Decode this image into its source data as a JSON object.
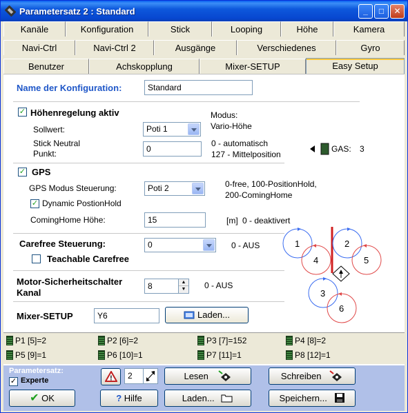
{
  "window": {
    "title": "Parametersatz 2 : Standard",
    "min": "_",
    "max": "□",
    "close": "✕"
  },
  "tabs": {
    "row1": [
      "Kanäle",
      "Konfiguration",
      "Stick",
      "Looping",
      "Höhe",
      "Kamera"
    ],
    "row2": [
      "Navi-Ctrl",
      "Navi-Ctrl 2",
      "Ausgänge",
      "Verschiedenes",
      "Gyro"
    ],
    "row3": [
      "Benutzer",
      "Achskopplung",
      "Mixer-SETUP",
      "Easy Setup"
    ]
  },
  "config": {
    "name_label": "Name der Konfiguration:",
    "name_value": "Standard"
  },
  "hoehe": {
    "checkbox_label": "Höhenregelung aktiv",
    "sollwert_label": "Sollwert:",
    "sollwert_value": "Poti 1",
    "modus_label": "Modus:",
    "modus_value": "Vario-Höhe",
    "stick_neutral_label_1": "Stick Neutral",
    "stick_neutral_label_2": "Punkt:",
    "stick_neutral_value": "0",
    "hint_1": "0 - automatisch",
    "hint_2": "127 - Mittelposition",
    "gas_label": "GAS:",
    "gas_value": "3"
  },
  "gps": {
    "checkbox_label": "GPS",
    "modus_label": "GPS Modus Steuerung:",
    "modus_value": "Poti 2",
    "modus_hint_1": "0-free, 100-PositionHold,",
    "modus_hint_2": "200-ComingHome",
    "dynamic_label": "Dynamic PostionHold",
    "cominghome_label": "ComingHome Höhe:",
    "cominghome_value": "15",
    "cominghome_unit": "[m]",
    "cominghome_hint": "0 - deaktivert"
  },
  "carefree": {
    "label": "Carefree Steuerung:",
    "value": "0",
    "hint": "0 - AUS",
    "teachable_label": "Teachable Carefree"
  },
  "motor": {
    "label_1": "Motor-Sicherheitschalter",
    "label_2": "Kanal",
    "value": "8",
    "hint": "0 - AUS"
  },
  "mixer": {
    "label": "Mixer-SETUP",
    "value": "Y6",
    "load_label": "Laden..."
  },
  "rotors": [
    "1",
    "2",
    "3",
    "4",
    "5",
    "6"
  ],
  "status": [
    "P1 [5]=2",
    "P2 [6]=2",
    "P3 [7]=152",
    "P4 [8]=2",
    "P5 [9]=1",
    "P6 [10]=1",
    "P7 [11]=1",
    "P8 [12]=1"
  ],
  "footer": {
    "paramsatz_label": "Parametersatz:",
    "experte_label": "Experte",
    "ok_label": "OK",
    "hilfe_label": "Hilfe",
    "set_value": "2",
    "lesen_label": "Lesen",
    "schreiben_label": "Schreiben",
    "laden_label": "Laden...",
    "speichern_label": "Speichern..."
  },
  "colors": {
    "title_bar": "#0a5ff0",
    "accent_blue": "#1f57c8",
    "rotor_blue": "#3a6cf0",
    "rotor_red": "#e04848",
    "boom_red": "#d02020"
  }
}
